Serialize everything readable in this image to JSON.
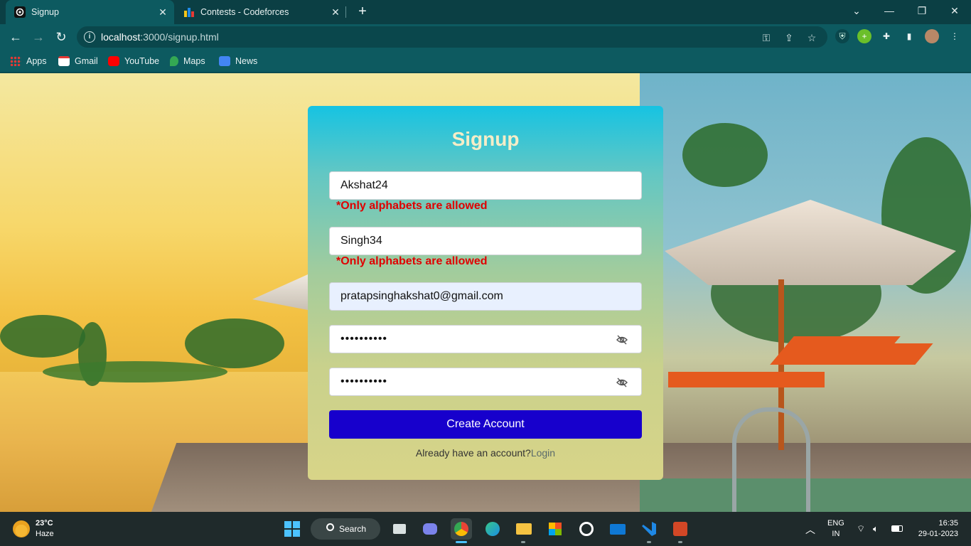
{
  "browser": {
    "tabs": [
      {
        "label": "Signup",
        "active": true
      },
      {
        "label": "Contests - Codeforces",
        "active": false
      }
    ],
    "url_host": "localhost",
    "url_rest": ":3000/signup.html",
    "bookmarks": [
      {
        "label": "Apps",
        "icon": "apps-grid-icon"
      },
      {
        "label": "Gmail",
        "icon": "gmail-icon"
      },
      {
        "label": "YouTube",
        "icon": "youtube-icon"
      },
      {
        "label": "Maps",
        "icon": "maps-icon"
      },
      {
        "label": "News",
        "icon": "news-icon"
      }
    ]
  },
  "form": {
    "title": "Signup",
    "first_name_value": "Akshat24",
    "first_name_error": "*Only alphabets are allowed",
    "last_name_value": "Singh34",
    "last_name_error": "*Only alphabets are allowed",
    "email_value": "pratapsinghakshat0@gmail.com",
    "password_masked": "••••••••••",
    "confirm_password_masked": "••••••••••",
    "submit_label": "Create Account",
    "login_prompt": "Already have an account?",
    "login_link": "Login"
  },
  "taskbar": {
    "temperature": "23°C",
    "condition": "Haze",
    "search_label": "Search",
    "language": "ENG",
    "region": "IN",
    "time": "16:35",
    "date": "29-01-2023"
  },
  "colors": {
    "submit_button": "#1700cc",
    "error_text": "#e00000",
    "title_text": "#f5edc7"
  }
}
